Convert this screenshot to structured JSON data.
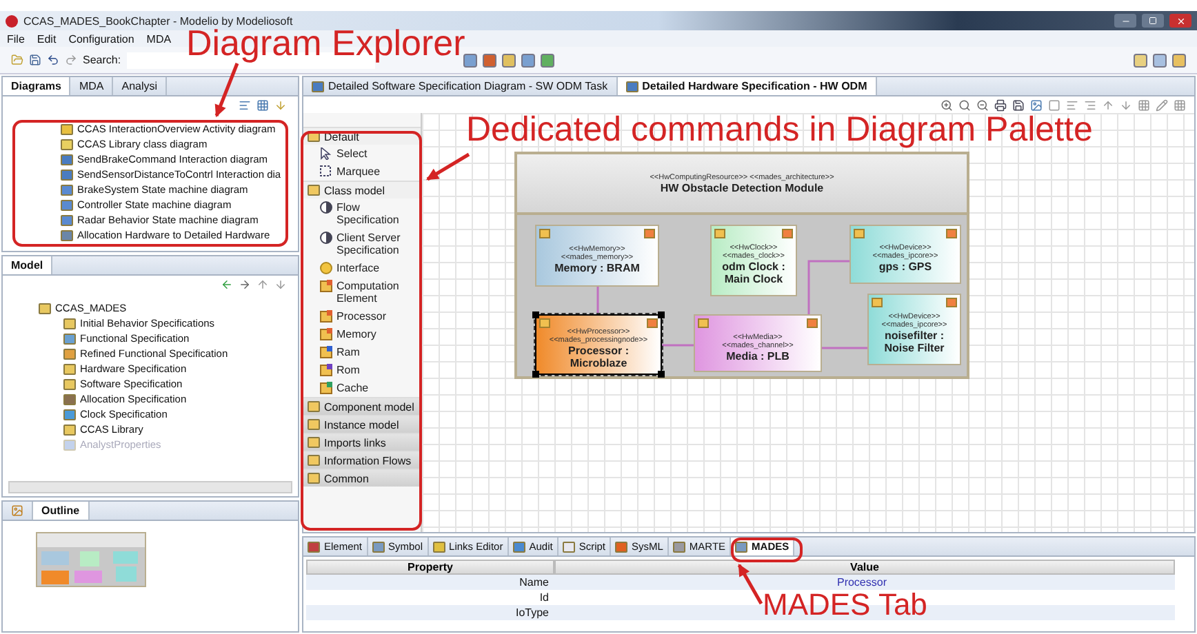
{
  "window": {
    "title": "CCAS_MADES_BookChapter - Modelio by Modeliosoft"
  },
  "menu": [
    "File",
    "Edit",
    "Configuration",
    "MDA"
  ],
  "toolbar": {
    "search_label": "Search:"
  },
  "explorer": {
    "tabs": [
      {
        "label": "Diagrams",
        "selected": true
      },
      {
        "label": "MDA",
        "selected": false
      },
      {
        "label": "Analysi",
        "selected": false
      }
    ],
    "diagrams": [
      {
        "label": "CCAS InteractionOverview Activity diagram",
        "kind": "activity"
      },
      {
        "label": "CCAS Library class diagram",
        "kind": "class"
      },
      {
        "label": "SendBrakeCommand Interaction diagram",
        "kind": "interaction"
      },
      {
        "label": "SendSensorDistanceToContrl Interaction dia",
        "kind": "interaction"
      },
      {
        "label": "BrakeSystem State machine diagram",
        "kind": "state"
      },
      {
        "label": "Controller State machine diagram",
        "kind": "state"
      },
      {
        "label": "Radar Behavior State machine diagram",
        "kind": "state"
      },
      {
        "label": "Allocation Hardware to Detailed Hardware",
        "kind": "allocation"
      }
    ]
  },
  "model": {
    "tab": "Model",
    "root": {
      "label": "CCAS_MADES",
      "children": [
        {
          "label": "Initial Behavior Specifications",
          "disabled": false
        },
        {
          "label": "Functional Specification",
          "disabled": false
        },
        {
          "label": "Refined Functional Specification",
          "disabled": false
        },
        {
          "label": "Hardware Specification",
          "disabled": false
        },
        {
          "label": "Software Specification",
          "disabled": false
        },
        {
          "label": "Allocation Specification",
          "disabled": false
        },
        {
          "label": "Clock Specification",
          "disabled": false
        },
        {
          "label": "CCAS Library",
          "disabled": false
        },
        {
          "label": "AnalystProperties",
          "disabled": true
        }
      ]
    }
  },
  "outline": {
    "tab": "Outline"
  },
  "editor_tabs": [
    {
      "label": "Detailed Software Specification Diagram - SW ODM Task",
      "selected": false
    },
    {
      "label": "Detailed Hardware Specification - HW ODM",
      "selected": true
    }
  ],
  "palette": [
    {
      "label": "Default",
      "expanded": true,
      "items": [
        {
          "label": "Select",
          "kind": "pointer"
        },
        {
          "label": "Marquee",
          "kind": "marquee"
        }
      ]
    },
    {
      "label": "Class model",
      "expanded": true,
      "items": [
        {
          "label": "Flow Specification",
          "kind": "flow"
        },
        {
          "label": "Client Server Specification",
          "kind": "flow"
        },
        {
          "label": "Interface",
          "kind": "interface"
        },
        {
          "label": "Computation Element",
          "kind": "block"
        },
        {
          "label": "Processor",
          "kind": "block"
        },
        {
          "label": "Memory",
          "kind": "block"
        },
        {
          "label": "Ram",
          "kind": "ram"
        },
        {
          "label": "Rom",
          "kind": "rom"
        },
        {
          "label": "Cache",
          "kind": "cache"
        }
      ]
    },
    {
      "label": "Component model",
      "expanded": false
    },
    {
      "label": "Instance model",
      "expanded": false
    },
    {
      "label": "Imports links",
      "expanded": false
    },
    {
      "label": "Information Flows",
      "expanded": false
    },
    {
      "label": "Common",
      "expanded": false
    }
  ],
  "diagram": {
    "container": {
      "stereotype": "<<HwComputingResource>> <<mades_architecture>>",
      "name": "HW Obstacle Detection Module"
    },
    "nodes": [
      {
        "stereotypes": [
          "<<HwMemory>>",
          "<<mades_memory>>"
        ],
        "name": "Memory : BRAM",
        "color": "#a9c8de",
        "selected": false
      },
      {
        "stereotypes": [
          "<<HwClock>>",
          "<<mades_clock>>"
        ],
        "name": "odm Clock : Main Clock",
        "color": "#b8ecc4",
        "selected": false
      },
      {
        "stereotypes": [
          "<<HwDevice>>",
          "<<mades_ipcore>>"
        ],
        "name": "gps : GPS",
        "color": "#8fdcd8",
        "selected": false
      },
      {
        "stereotypes": [
          "<<HwProcessor>>",
          "<<mades_processingnode>>"
        ],
        "name": "Processor : Microblaze",
        "color": "#f08a2a",
        "selected": true
      },
      {
        "stereotypes": [
          "<<HwMedia>>",
          "<<mades_channel>>"
        ],
        "name": "Media : PLB",
        "color": "#df96e0",
        "selected": false
      },
      {
        "stereotypes": [
          "<<HwDevice>>",
          "<<mades_ipcore>>"
        ],
        "name": "noisefilter : Noise Filter",
        "color": "#8fdcd8",
        "selected": false
      }
    ]
  },
  "bottom_tabs": [
    {
      "label": "Element",
      "selected": false
    },
    {
      "label": "Symbol",
      "selected": false
    },
    {
      "label": "Links Editor",
      "selected": false
    },
    {
      "label": "Audit",
      "selected": false
    },
    {
      "label": "Script",
      "selected": false
    },
    {
      "label": "SysML",
      "selected": false
    },
    {
      "label": "MARTE",
      "selected": false
    },
    {
      "label": "MADES",
      "selected": true
    }
  ],
  "properties": {
    "columns": [
      "Property",
      "Value"
    ],
    "rows": [
      {
        "property": "Name",
        "value": "Processor"
      },
      {
        "property": "Id"
      },
      {
        "property": "IoType"
      }
    ]
  },
  "annotations": [
    {
      "text": "Diagram Explorer"
    },
    {
      "text": "Dedicated commands in Diagram Palette"
    },
    {
      "text": "MADES Tab"
    }
  ]
}
